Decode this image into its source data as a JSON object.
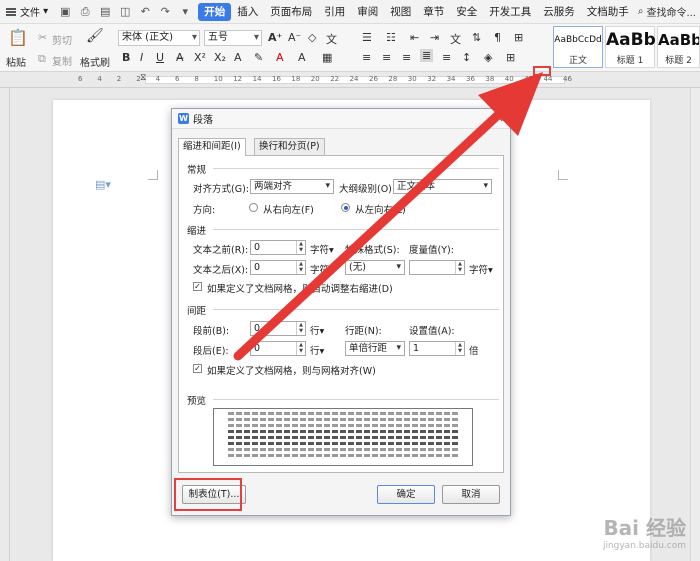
{
  "menubar": {
    "file_label": "文件",
    "tabs": [
      "开始",
      "插入",
      "页面布局",
      "引用",
      "审阅",
      "视图",
      "章节",
      "安全",
      "开发工具",
      "云服务",
      "文档助手"
    ],
    "active_tab": "开始",
    "search_label": "查找命令..."
  },
  "ribbon": {
    "paste_label": "粘贴",
    "cut_label": "剪切",
    "copy_label": "复制",
    "format_painter_label": "格式刷",
    "font_name": "宋体 (正文)",
    "font_size": "五号",
    "styles": [
      {
        "sample": "AaBbCcDd",
        "name": "正文"
      },
      {
        "sample": "AaBb",
        "name": "标题 1"
      },
      {
        "sample": "AaBb",
        "name": "标题 2"
      }
    ]
  },
  "ruler": {
    "ticks": [
      "6",
      "4",
      "2",
      "2",
      "4",
      "6",
      "8",
      "10",
      "12",
      "14",
      "16",
      "18",
      "20",
      "22",
      "24",
      "26",
      "28",
      "30",
      "32",
      "34",
      "36",
      "38",
      "40",
      "42",
      "44",
      "46"
    ]
  },
  "dialog": {
    "title": "段落",
    "tabs": [
      "缩进和间距(I)",
      "换行和分页(P)"
    ],
    "general": {
      "section": "常规",
      "align_label": "对齐方式(G):",
      "align_value": "两端对齐",
      "outline_label": "大纲级别(O):",
      "outline_value": "正文文本",
      "direction_label": "方向:",
      "rtl_label": "从右向左(F)",
      "ltr_label": "从左向右(L)"
    },
    "indent": {
      "section": "缩进",
      "before_label": "文本之前(R):",
      "before_value": "0",
      "before_unit": "字符▾",
      "special_label": "特殊格式(S):",
      "special_value": "(无)",
      "measure_label": "度量值(Y):",
      "measure_value": "",
      "measure_unit": "字符▾",
      "after_label": "文本之后(X):",
      "after_value": "0",
      "after_unit": "字符▾",
      "grid_check_label": "如果定义了文档网格，则自动调整右缩进(D)"
    },
    "spacing": {
      "section": "间距",
      "before_label": "段前(B):",
      "before_value": "0",
      "before_unit": "行▾",
      "line_label": "行距(N):",
      "line_value": "单倍行距",
      "setting_label": "设置值(A):",
      "setting_value": "1",
      "setting_unit": "倍",
      "after_label": "段后(E):",
      "after_value": "0",
      "after_unit": "行▾",
      "grid_check_label": "如果定义了文档网格，则与网格对齐(W)"
    },
    "preview_label": "预览",
    "tabs_button": "制表位(T)...",
    "ok_button": "确定",
    "cancel_button": "取消"
  },
  "watermark": {
    "main": "Bai 经验",
    "sub": "jingyan.baidu.com"
  },
  "colors": {
    "accent": "#3b7be8",
    "arrow": "#e53935",
    "highlight": "#e04040"
  }
}
